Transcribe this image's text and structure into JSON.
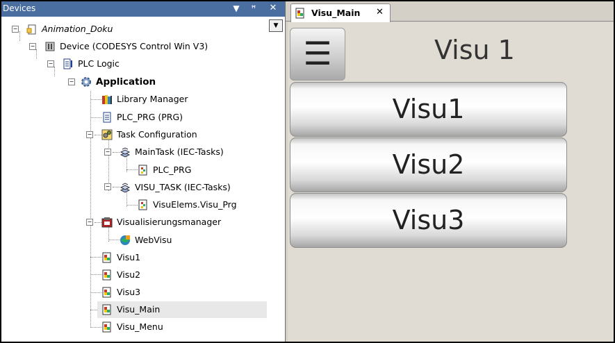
{
  "devices_panel": {
    "title": "Devices",
    "dropdown_glyph": "▼",
    "pin_glyph": "ꟸ",
    "close_glyph": "✕"
  },
  "tree_dropdown_glyph": "▼",
  "tree": {
    "expanded_glyph": "−",
    "items": [
      {
        "label": "Animation_Doku",
        "icon": "project-icon"
      },
      {
        "label": "Device (CODESYS Control Win V3)",
        "icon": "device-icon"
      },
      {
        "label": "PLC Logic",
        "icon": "plc-logic-icon"
      },
      {
        "label": "Application",
        "icon": "application-gear-icon"
      },
      {
        "label": "Library Manager",
        "icon": "library-manager-icon"
      },
      {
        "label": "PLC_PRG (PRG)",
        "icon": "program-document-icon"
      },
      {
        "label": "Task Configuration",
        "icon": "task-configuration-icon"
      },
      {
        "label": "MainTask (IEC-Tasks)",
        "icon": "task-icon"
      },
      {
        "label": "PLC_PRG",
        "icon": "program-call-icon"
      },
      {
        "label": "VISU_TASK (IEC-Tasks)",
        "icon": "task-icon"
      },
      {
        "label": "VisuElems.Visu_Prg",
        "icon": "program-call-icon"
      },
      {
        "label": "Visualisierungsmanager",
        "icon": "visualization-manager-icon"
      },
      {
        "label": "WebVisu",
        "icon": "webvisu-icon"
      },
      {
        "label": "Visu1",
        "icon": "visualization-icon"
      },
      {
        "label": "Visu2",
        "icon": "visualization-icon"
      },
      {
        "label": "Visu3",
        "icon": "visualization-icon"
      },
      {
        "label": "Visu_Main",
        "icon": "visualization-icon"
      },
      {
        "label": "Visu_Menu",
        "icon": "visualization-icon"
      }
    ]
  },
  "editor": {
    "tab": {
      "label": "Visu_Main",
      "close_glyph": "✕",
      "icon": "visualization-icon"
    },
    "canvas": {
      "menu_glyph": "☰",
      "title": "Visu 1",
      "buttons": [
        "Visu1",
        "Visu2",
        "Visu3"
      ]
    }
  },
  "colors": {
    "panel_header": "#4a6e9f",
    "selection": "#e8e8e8",
    "canvas_bg": "#e0dbd3"
  }
}
